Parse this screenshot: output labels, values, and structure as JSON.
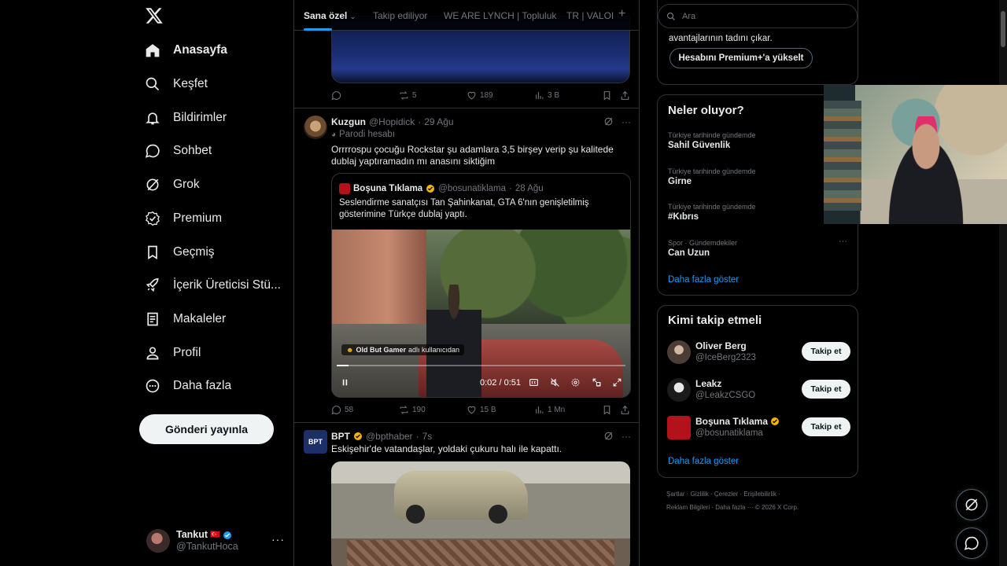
{
  "nav": {
    "items": [
      {
        "label": "Anasayfa",
        "icon": "home-icon"
      },
      {
        "label": "Keşfet",
        "icon": "search-icon"
      },
      {
        "label": "Bildirimler",
        "icon": "bell-icon"
      },
      {
        "label": "Sohbet",
        "icon": "chat-icon"
      },
      {
        "label": "Grok",
        "icon": "grok-icon"
      },
      {
        "label": "Premium",
        "icon": "premium-icon"
      },
      {
        "label": "Geçmiş",
        "icon": "bookmark-icon"
      },
      {
        "label": "İçerik Üreticisi Stü...",
        "icon": "rocket-icon"
      },
      {
        "label": "Makaleler",
        "icon": "articles-icon"
      },
      {
        "label": "Profil",
        "icon": "profile-icon"
      },
      {
        "label": "Daha fazla",
        "icon": "more-circle-icon"
      }
    ],
    "post_button": "Gönderi yayınla"
  },
  "account": {
    "name": "Tankut",
    "handle": "@TankutHoca",
    "flag": "🇹🇷",
    "more": "···"
  },
  "tabs": {
    "items": [
      "Sana özel",
      "Takip ediliyor",
      "WE ARE LYNCH | Topluluk",
      "TR | VALOI"
    ],
    "plus": "+"
  },
  "tweet0": {
    "replies": "",
    "retweets": "5",
    "likes": "189",
    "views": "3 B"
  },
  "tweet1": {
    "name": "Kuzgun",
    "handle": "@Hopidick",
    "time": "29 Ağu",
    "parody": "Parodi hesabı",
    "text": "Orrrrospu çocuğu Rockstar şu adamlara 3,5 birşey verip şu kalitede dublaj yaptıramadın mı anasını siktiğim",
    "quote": {
      "name": "Boşuna Tıklama",
      "handle": "@bosunatiklama",
      "time": "28 Ağu",
      "text": "Seslendirme sanatçısı Tan Şahinkanat, GTA 6'nın genişletilmiş gösterimine Türkçe dublaj yaptı.",
      "badge_user": "Old But Gamer",
      "badge_suffix": "adlı kullanıcıdan",
      "time_display": "0:02  /  0:51",
      "progress": 0.04
    },
    "replies": "58",
    "retweets": "190",
    "likes": "15 B",
    "views": "1 Mn"
  },
  "tweet2": {
    "name": "BPT",
    "handle": "@bpthaber",
    "time": "7s",
    "text": "Eskişehir'de vatandaşlar, yoldaki çukuru halı ile kapattı."
  },
  "right": {
    "search_placeholder": "Ara",
    "premium_text": "avantajlarının tadını çıkar.",
    "premium_button": "Hesabını Premium+'a yükselt",
    "trends_title": "Neler oluyor?",
    "trends": [
      {
        "context": "Türkiye tarihinde gündemde",
        "name": "Sahil Güvenlik"
      },
      {
        "context": "Türkiye tarihinde gündemde",
        "name": "Girne"
      },
      {
        "context": "Türkiye tarihinde gündemde",
        "name": "#Kıbrıs"
      },
      {
        "context": "Spor · Gündemdekiler",
        "name": "Can Uzun"
      }
    ],
    "trends_more": "Daha fazla göster",
    "follow_title": "Kimi takip etmeli",
    "follow": [
      {
        "name": "Oliver Berg",
        "handle": "@IceBerg2323",
        "verified": false,
        "button": "Takip et"
      },
      {
        "name": "Leakz",
        "handle": "@LeakzCSGO",
        "verified": false,
        "button": "Takip et"
      },
      {
        "name": "Boşuna Tıklama",
        "handle": "@bosunatiklama",
        "verified": true,
        "button": "Takip et"
      }
    ],
    "follow_more": "Daha fazla göster",
    "footer_line1": "Şartlar  ·  Gizlilik  ·  Çerezler  ·  Erişilebilirlik  ·",
    "footer_line2": "Reklam Bilgileri  ·  Daha fazla ···  © 2026 X Corp."
  },
  "colors": {
    "accent": "#1d9bf0",
    "verified": "#f4b400",
    "border": "#2f3336",
    "muted": "#71767b"
  }
}
